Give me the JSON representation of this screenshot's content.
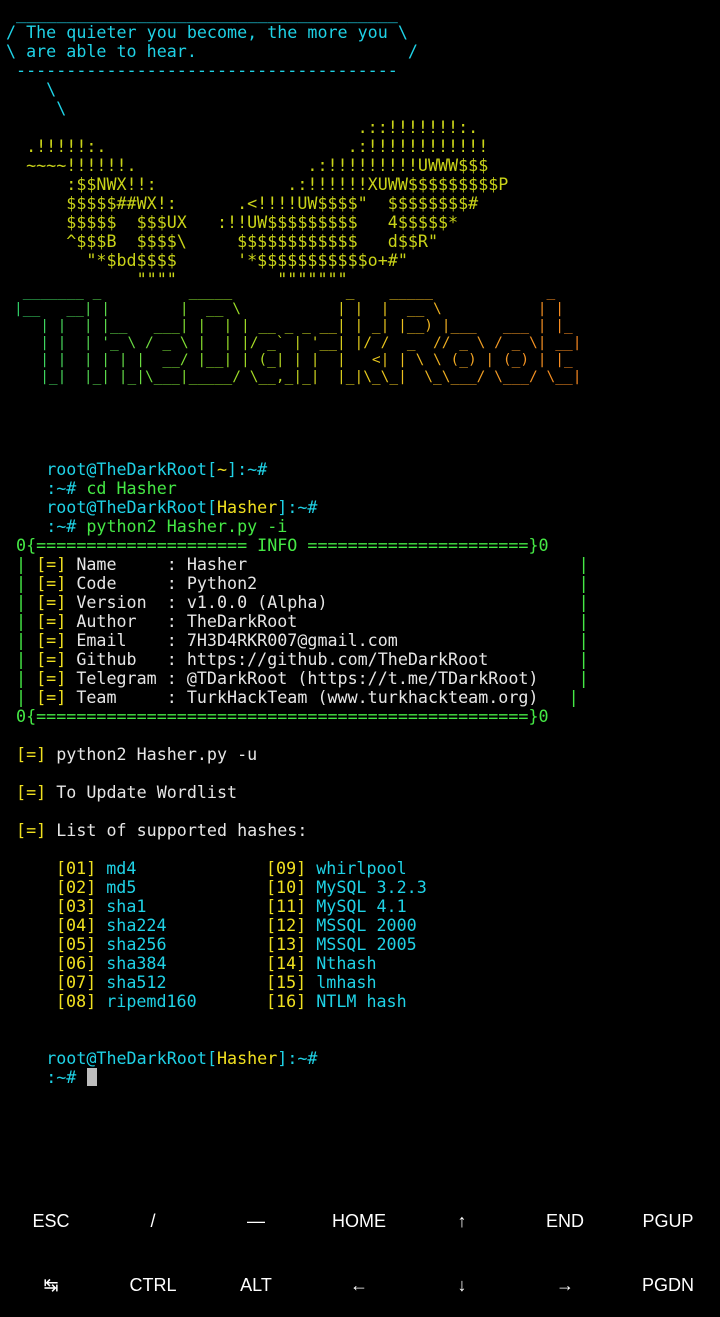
{
  "terminal": {
    "quote": {
      "top": " ______________________________________",
      "l1": "/ The quieter you become, the more you \\",
      "l2": "\\ are able to hear.                     /",
      "bottom": " --------------------------------------",
      "tail1": "    \\",
      "tail2": "     \\"
    },
    "dragon": [
      "                                   .::!!!!!!!:.",
      "  .!!!!!:.                        .:!!!!!!!!!!!!",
      "  ~~~~!!!!!!.                 .:!!!!!!!!!UWWW$$$",
      "      :$$NWX!!:             .:!!!!!!XUWW$$$$$$$$$P",
      "      $$$$$##WX!:      .<!!!!UW$$$$\"  $$$$$$$$#",
      "      $$$$$  $$$UX   :!!UW$$$$$$$$$   4$$$$$*",
      "      ^$$$B  $$$$\\     $$$$$$$$$$$$   d$$R\"",
      "        \"*$bd$$$$      '*$$$$$$$$$$$o+#\"",
      "             \"\"\"\"          \"\"\"\"\"\"\""
    ],
    "logo_art": [
      " _______ _          _____             _    _____             _   ",
      "|__   __| |        |  __ \\           | |  |  __ \\           | |  ",
      "   | |  | |__   ___| |  | | __ _ _ __| | _| |__) |___   ___ | |_ ",
      "   | |  | '_ \\ / _ \\ |  | |/ _` | '__| |/ /  _  // _ \\ / _ \\| __|",
      "   | |  | | | |  __/ |__| | (_| | |  |   <| | \\ \\ (_) | (_) | |_ ",
      "   |_|  |_| |_|\\___|_____/ \\__,_|_|  |_|\\_\\_|  \\_\\___/ \\___/ \\__|"
    ],
    "prompt_user": "root@TheDarkRoot",
    "prompt_open": "[",
    "prompt_close": "]",
    "prompt_tail": ":~#",
    "dir_home": "~",
    "dir_hasher": "Hasher",
    "short_prompt": ":~#",
    "cmd1": " cd Hasher",
    "cmd2": " python2 Hasher.py -i",
    "info": {
      "top_left": " 0{",
      "top_mid": "===================== INFO ======================",
      "top_right": "}0",
      "rows": [
        {
          "key": "Name    ",
          "val": "Hasher",
          "pad": "                                 "
        },
        {
          "key": "Code    ",
          "val": "Python2",
          "pad": "                                "
        },
        {
          "key": "Version ",
          "val": "v1.0.0 (Alpha)",
          "pad": "                         "
        },
        {
          "key": "Author  ",
          "val": "TheDarkRoot",
          "pad": "                            "
        },
        {
          "key": "Email   ",
          "val": "7H3D4RKR007@gmail.com",
          "pad": "                  "
        },
        {
          "key": "Github  ",
          "val": "https://github.com/TheDarkRoot",
          "pad": "         "
        },
        {
          "key": "Telegram",
          "val": "@TDarkRoot (https://t.me/TDarkRoot)",
          "pad": "    "
        },
        {
          "key": "Team    ",
          "val": "TurkHackTeam (www.turkhackteam.org)",
          "pad": "   "
        }
      ],
      "bottom_mid": "================================================="
    },
    "marker": "[=]",
    "notes": [
      "python2 Hasher.py -u",
      "To Update Wordlist",
      "List of supported hashes:"
    ],
    "hashes_left": [
      {
        "num": "[01]",
        "name": "md4"
      },
      {
        "num": "[02]",
        "name": "md5"
      },
      {
        "num": "[03]",
        "name": "sha1"
      },
      {
        "num": "[04]",
        "name": "sha224"
      },
      {
        "num": "[05]",
        "name": "sha256"
      },
      {
        "num": "[06]",
        "name": "sha384"
      },
      {
        "num": "[07]",
        "name": "sha512"
      },
      {
        "num": "[08]",
        "name": "ripemd160"
      }
    ],
    "hashes_right": [
      {
        "num": "[09]",
        "name": "whirlpool"
      },
      {
        "num": "[10]",
        "name": "MySQL 3.2.3"
      },
      {
        "num": "[11]",
        "name": "MySQL 4.1"
      },
      {
        "num": "[12]",
        "name": "MSSQL 2000"
      },
      {
        "num": "[13]",
        "name": "MSSQL 2005"
      },
      {
        "num": "[14]",
        "name": "Nthash"
      },
      {
        "num": "[15]",
        "name": "lmhash"
      },
      {
        "num": "[16]",
        "name": "NTLM hash"
      }
    ]
  },
  "extra_keys": {
    "row1": [
      "ESC",
      "/",
      "—",
      "HOME",
      "↑",
      "END",
      "PGUP"
    ],
    "row2": [
      "↹",
      "CTRL",
      "ALT",
      "←",
      "↓",
      "→",
      "PGDN"
    ]
  }
}
